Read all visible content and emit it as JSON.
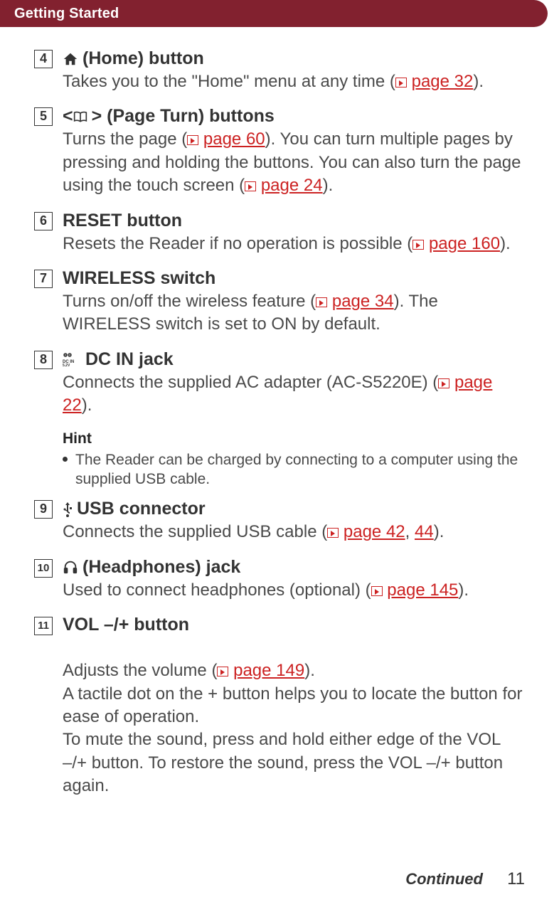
{
  "header": {
    "title": "Getting Started"
  },
  "items": [
    {
      "num": "4",
      "icon": "home",
      "title": " (Home) button",
      "desc_parts": [
        "Takes you to the \"Home\" menu at any time (",
        "page 32",
        ")."
      ]
    },
    {
      "num": "5",
      "icon": "book",
      "title_prefix": "< ",
      "title_suffix": " > (Page Turn) buttons",
      "desc_parts": [
        "Turns the page (",
        "page 60",
        "). You can turn multiple pages by pressing and holding the buttons. You can also turn the page using the touch screen (",
        "page 24",
        ")."
      ]
    },
    {
      "num": "6",
      "title": "RESET button",
      "desc_parts": [
        "Resets the Reader if no operation is possible (",
        "page 160",
        ")."
      ]
    },
    {
      "num": "7",
      "title": "WIRELESS switch",
      "desc_parts": [
        "Turns on/off the wireless feature (",
        "page 34",
        "). The WIRELESS switch is set to ON by default."
      ]
    },
    {
      "num": "8",
      "icon": "dcin",
      "title": " DC IN jack",
      "desc_parts": [
        "Connects the supplied AC adapter (AC-S5220E) (",
        "page 22",
        ")."
      ]
    },
    {
      "num": "9",
      "icon": "usb",
      "title": " USB connector",
      "desc_parts": [
        "Connects the supplied USB cable (",
        "page 42",
        ", ",
        "44",
        ")."
      ]
    },
    {
      "num": "10",
      "icon": "headphones",
      "title": " (Headphones) jack",
      "desc_parts": [
        "Used to connect headphones (optional) (",
        "page 145",
        ")."
      ]
    },
    {
      "num": "11",
      "title": "VOL –/+ button",
      "desc_parts": [
        "Adjusts the volume (",
        "page 149",
        ").\nA tactile dot on the + button helps you to locate the button for ease of operation.\nTo mute the sound, press and hold either edge of the VOL –/+ button. To restore the sound, press the VOL –/+ button again."
      ]
    }
  ],
  "hint": {
    "title": "Hint",
    "text": "The Reader can be charged by connecting to a computer using the supplied USB cable."
  },
  "footer": {
    "continued": "Continued",
    "page": "11"
  }
}
